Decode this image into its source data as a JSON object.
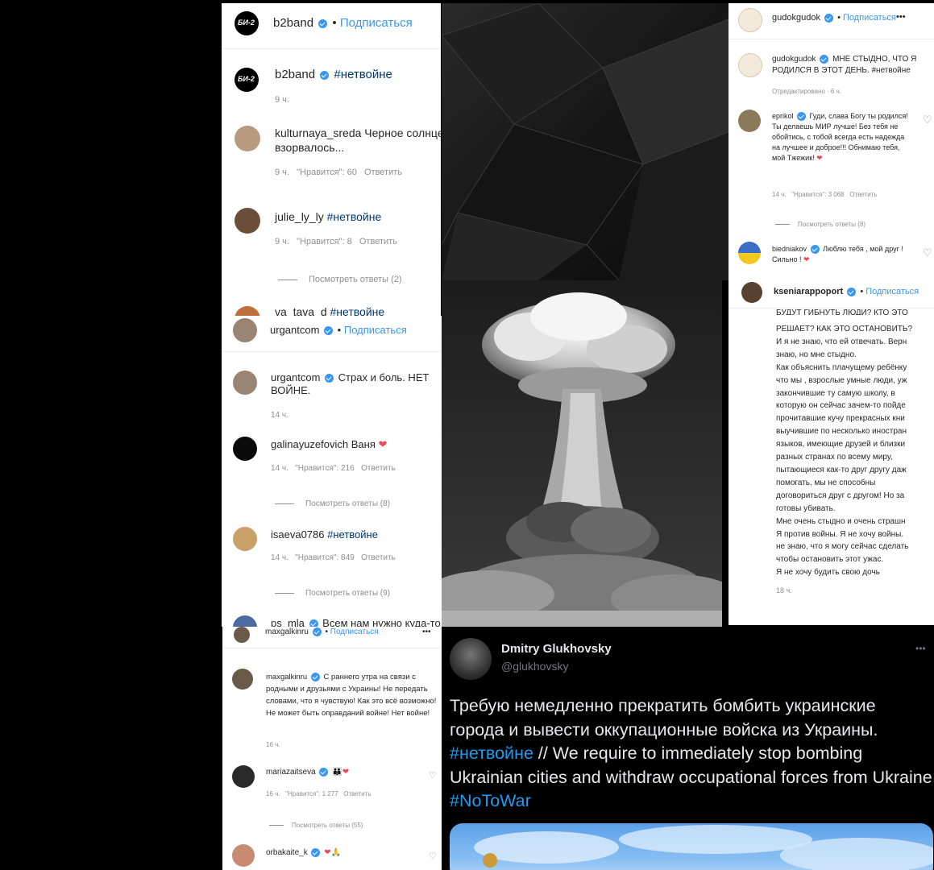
{
  "panel_b2band": {
    "header_user": "b2band",
    "follow": "Подписаться",
    "avatar_text": "БИ-2",
    "caption_user": "b2band",
    "caption_text": "#нетвойне",
    "caption_time": "9 ч.",
    "comments": [
      {
        "user": "kulturnaya_sreda",
        "text": "Черное солнце взорвалось...",
        "meta": "9 ч.   \"Нравится\": 60   Ответить"
      },
      {
        "user": "julie_ly_ly",
        "text": "#нетвойне",
        "meta": "9 ч.   \"Нравится\": 8   Ответить"
      }
    ],
    "view_replies": "Посмотреть ответы (2)",
    "cut_user": "va_tava_d",
    "cut_text": "#нетвойне"
  },
  "panel_urgant": {
    "header_user": "urgantcom",
    "follow": "Подписаться",
    "caption_user": "urgantcom",
    "caption_text": "Страх и боль. НЕТ ВОЙНЕ.",
    "caption_time": "14 ч.",
    "comments": [
      {
        "user": "galinayuzefovich",
        "text": "Ваня",
        "meta": "14 ч.   \"Нравится\": 216   Ответить",
        "replies": "Посмотреть ответы (8)"
      },
      {
        "user": "isaeva0786",
        "text": "#нетвойне",
        "meta": "14 ч.   \"Нравится\": 849   Ответить",
        "replies": "Посмотреть ответы (9)"
      }
    ],
    "cut_user": "ps_mla",
    "cut_text": "Всем нам нужно куда-то"
  },
  "panel_gudok": {
    "header_user": "gudokgudok",
    "follow": "Подписаться",
    "more": "•••",
    "caption_user": "gudokgudok",
    "caption_text": "МНЕ СТЫДНО, ЧТО Я РОДИЛСЯ В ЭТОТ ДЕНЬ. #нетвойне",
    "edited": "Отредактировано · 6 ч.",
    "c1_user": "eprikol",
    "c1_text": "Гуди, слава Богу ты родился! Ты делаешь МИР лучше! Без тебя не обойтись, с тобой всегда есть надежда на лучшее и доброе!!! Обнимаю тебя, мой Тжежик!",
    "c1_meta": "14 ч.   \"Нравится\": 3 068   Ответить",
    "c1_replies": "Посмотреть ответы (8)",
    "c2_user": "biedniakov",
    "c2_text": "Люблю тебя , мой друг ! Сильно !"
  },
  "panel_ksenia": {
    "header_user": "kseniarappoport",
    "follow": "Подписаться",
    "cut_line": "БУДУТ ГИБНУТЬ ЛЮДИ? КТО ЭТО",
    "lines": [
      "РЕШАЕТ? КАК ЭТО ОСТАНОВИТЬ?",
      "И я не знаю, что ей отвечать. Верн",
      "знаю, но мне стыдно.",
      "Как объяснить плачущему ребёнку",
      "что мы , взрослые умные люди, уж",
      "закончившие ту самую школу, в",
      "которую он сейчас зачем-то пойде",
      "прочитавшие кучу прекрасных кни",
      "выучившие по несколько иностран",
      "языков, имеющие друзей и близки",
      "разных странах по всему миру,",
      "пытающиеся как-то друг другу даж",
      "помогать, мы не способны",
      "договориться друг с другом! Но за",
      "готовы убивать.",
      "Мне очень стыдно и очень страшн",
      "Я против войны. Я не хочу войны.",
      "не знаю, что я могу сейчас сделать",
      "чтобы остановить этот ужас.",
      "Я не хочу будить свою дочь"
    ],
    "time": "18 ч."
  },
  "panel_galkin": {
    "header_user": "maxgalkinru",
    "follow": "Подписаться",
    "more": "•••",
    "caption_user": "maxgalkinru",
    "caption_text": "С раннего утра на связи с родными и друзьями с Украины! Не передать словами, что я чувствую! Как это всё возможно! Не может быть оправданий войне! Нет войне!",
    "caption_time": "16 ч.",
    "c1_user": "mariazaitseva",
    "c1_meta": "16 ч.   \"Нравится\": 1 277   Ответить",
    "c1_replies": "Посмотреть ответы (55)",
    "c2_user": "orbakaite_k"
  },
  "tweet": {
    "name": "Dmitry Glukhovsky",
    "handle": "@glukhovsky",
    "more": "•••",
    "text_ru": "Требую немедленно прекратить бомбить украинские города и вывести оккупационные войска из Украины.",
    "hashtag1": "#нетвойне",
    "text_en": "// We require to immediately stop bombing Ukrainian cities and withdraw occupational forces from Ukraine",
    "hashtag2": "#NoToWar"
  },
  "colors": {
    "instagram_blue": "#3897f0",
    "hashtag_blue": "#00376b",
    "heart_red": "#ed4956",
    "twitter_bg": "#000000",
    "twitter_link": "#1d9bf0"
  }
}
